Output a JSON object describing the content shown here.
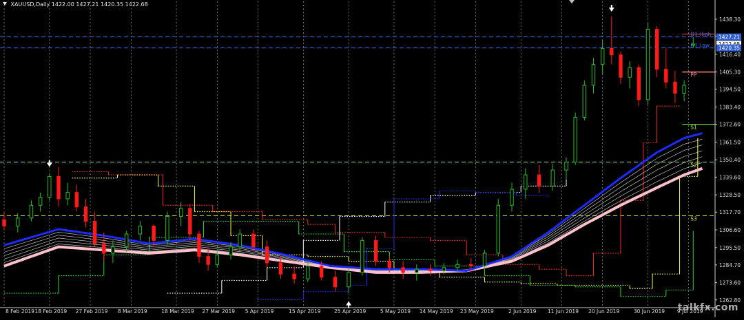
{
  "header": {
    "symbol": "XAUUSD,Daily",
    "ohlc": "1422.00 1427.21 1420.35 1422.68"
  },
  "watermark": "talkfx.com",
  "price_scale": {
    "ticks": [
      "1438.30",
      "1427.50",
      "1416.40",
      "1405.30",
      "1394.50",
      "1383.40",
      "1372.60",
      "1361.50",
      "1350.40",
      "1339.60",
      "1328.50",
      "1317.70",
      "1306.60",
      "1295.50",
      "1284.70",
      "1273.60",
      "1262.80"
    ],
    "tick_values": [
      1438.3,
      1427.5,
      1416.4,
      1405.3,
      1394.5,
      1383.4,
      1372.6,
      1361.5,
      1350.4,
      1339.6,
      1328.5,
      1317.7,
      1306.6,
      1295.5,
      1284.7,
      1273.6,
      1262.8
    ],
    "tags": [
      {
        "text": "1427.21",
        "value": 1427.21,
        "bg": "#2f5fd0",
        "fg": "#ffffff"
      },
      {
        "text": "1422.68",
        "value": 1422.68,
        "bg": "#ffffff",
        "fg": "#000000"
      },
      {
        "text": "1420.35",
        "value": 1420.35,
        "bg": "#2f5fd0",
        "fg": "#ffffff"
      }
    ]
  },
  "date_labels": [
    "8 Feb 2019",
    "18 Feb 2019",
    "27 Feb 2019",
    "8 Mar 2019",
    "18 Mar 2019",
    "27 Mar 2019",
    "5 Apr 2019",
    "15 Apr 2019",
    "25 Apr 2019",
    "5 May 2019",
    "14 May 2019",
    "23 May 2019",
    "2 Jun 2019",
    "11 Jun 2019",
    "20 Jun 2019",
    "30 Jun 2019",
    "9 Jul 2019"
  ],
  "level_lines": [
    {
      "label": "D1 High",
      "value": 1427.21,
      "color": "#2f6bff",
      "dash": true
    },
    {
      "label": "D1 Low",
      "value": 1420.35,
      "color": "#2f6bff",
      "dash": true
    },
    {
      "label": "",
      "value": 1429.0,
      "color": "#ff4040",
      "dash": false
    },
    {
      "label": "PP",
      "value": 1405.3,
      "color": "#ff8080",
      "dash": false
    },
    {
      "label": "S1",
      "value": 1372.6,
      "color": "#7fff3a",
      "dash": false
    },
    {
      "label": "S2",
      "value": 1349.0,
      "color": "#b4e04a",
      "dash": true
    },
    {
      "label": "S3",
      "value": 1315.5,
      "color": "#cfe040",
      "dash": true
    }
  ],
  "colors": {
    "background": "#000000",
    "bull": "#22c122",
    "bear": "#ff1a1a",
    "ma_fast": "#1a2cff",
    "ma_slow": "#ffc0cb",
    "ribbon": "#ffffff",
    "grid_dates": "#ffffff",
    "axis_text": "#dddddd"
  },
  "chart_data": {
    "type": "candlestick",
    "title": "XAUUSD,Daily",
    "ylim": [
      1258,
      1446
    ],
    "x_range_days": [
      0,
      155
    ],
    "date_label_days": [
      0,
      10,
      19,
      28,
      38,
      47,
      56,
      66,
      76,
      86,
      95,
      104,
      114,
      123,
      132,
      142,
      151
    ],
    "candles": [
      {
        "d": 0,
        "o": 1313,
        "h": 1318,
        "l": 1306,
        "c": 1309
      },
      {
        "d": 3,
        "o": 1309,
        "h": 1317,
        "l": 1305,
        "c": 1314
      },
      {
        "d": 6,
        "o": 1314,
        "h": 1325,
        "l": 1312,
        "c": 1322
      },
      {
        "d": 8,
        "o": 1322,
        "h": 1330,
        "l": 1318,
        "c": 1327
      },
      {
        "d": 10,
        "o": 1327,
        "h": 1342,
        "l": 1325,
        "c": 1340
      },
      {
        "d": 12,
        "o": 1340,
        "h": 1346,
        "l": 1321,
        "c": 1326
      },
      {
        "d": 14,
        "o": 1326,
        "h": 1336,
        "l": 1322,
        "c": 1330
      },
      {
        "d": 16,
        "o": 1330,
        "h": 1335,
        "l": 1318,
        "c": 1321
      },
      {
        "d": 18,
        "o": 1321,
        "h": 1326,
        "l": 1308,
        "c": 1312
      },
      {
        "d": 20,
        "o": 1312,
        "h": 1318,
        "l": 1296,
        "c": 1298
      },
      {
        "d": 22,
        "o": 1298,
        "h": 1305,
        "l": 1287,
        "c": 1292
      },
      {
        "d": 24,
        "o": 1292,
        "h": 1300,
        "l": 1286,
        "c": 1296
      },
      {
        "d": 27,
        "o": 1296,
        "h": 1306,
        "l": 1293,
        "c": 1304
      },
      {
        "d": 30,
        "o": 1304,
        "h": 1312,
        "l": 1300,
        "c": 1309
      },
      {
        "d": 33,
        "o": 1309,
        "h": 1310,
        "l": 1296,
        "c": 1300
      },
      {
        "d": 36,
        "o": 1300,
        "h": 1318,
        "l": 1297,
        "c": 1315
      },
      {
        "d": 39,
        "o": 1315,
        "h": 1324,
        "l": 1309,
        "c": 1320
      },
      {
        "d": 41,
        "o": 1320,
        "h": 1323,
        "l": 1300,
        "c": 1304
      },
      {
        "d": 43,
        "o": 1304,
        "h": 1306,
        "l": 1286,
        "c": 1290
      },
      {
        "d": 45,
        "o": 1290,
        "h": 1296,
        "l": 1281,
        "c": 1285
      },
      {
        "d": 47,
        "o": 1285,
        "h": 1294,
        "l": 1283,
        "c": 1291
      },
      {
        "d": 50,
        "o": 1291,
        "h": 1299,
        "l": 1288,
        "c": 1296
      },
      {
        "d": 52,
        "o": 1296,
        "h": 1307,
        "l": 1293,
        "c": 1304
      },
      {
        "d": 55,
        "o": 1304,
        "h": 1307,
        "l": 1293,
        "c": 1296
      },
      {
        "d": 58,
        "o": 1296,
        "h": 1300,
        "l": 1283,
        "c": 1286
      },
      {
        "d": 61,
        "o": 1286,
        "h": 1290,
        "l": 1276,
        "c": 1279
      },
      {
        "d": 64,
        "o": 1279,
        "h": 1284,
        "l": 1273,
        "c": 1276
      },
      {
        "d": 67,
        "o": 1276,
        "h": 1287,
        "l": 1274,
        "c": 1284
      },
      {
        "d": 70,
        "o": 1284,
        "h": 1287,
        "l": 1275,
        "c": 1277
      },
      {
        "d": 73,
        "o": 1277,
        "h": 1281,
        "l": 1268,
        "c": 1271
      },
      {
        "d": 76,
        "o": 1271,
        "h": 1283,
        "l": 1267,
        "c": 1280
      },
      {
        "d": 79,
        "o": 1280,
        "h": 1302,
        "l": 1278,
        "c": 1300
      },
      {
        "d": 82,
        "o": 1300,
        "h": 1303,
        "l": 1284,
        "c": 1287
      },
      {
        "d": 85,
        "o": 1287,
        "h": 1290,
        "l": 1280,
        "c": 1283
      },
      {
        "d": 88,
        "o": 1283,
        "h": 1287,
        "l": 1276,
        "c": 1280
      },
      {
        "d": 91,
        "o": 1280,
        "h": 1285,
        "l": 1275,
        "c": 1282
      },
      {
        "d": 94,
        "o": 1282,
        "h": 1285,
        "l": 1278,
        "c": 1281
      },
      {
        "d": 97,
        "o": 1281,
        "h": 1286,
        "l": 1279,
        "c": 1283
      },
      {
        "d": 100,
        "o": 1283,
        "h": 1288,
        "l": 1281,
        "c": 1285
      },
      {
        "d": 103,
        "o": 1285,
        "h": 1289,
        "l": 1280,
        "c": 1284
      },
      {
        "d": 106,
        "o": 1284,
        "h": 1294,
        "l": 1282,
        "c": 1292
      },
      {
        "d": 109,
        "o": 1292,
        "h": 1326,
        "l": 1290,
        "c": 1322
      },
      {
        "d": 112,
        "o": 1322,
        "h": 1336,
        "l": 1318,
        "c": 1332
      },
      {
        "d": 115,
        "o": 1332,
        "h": 1345,
        "l": 1326,
        "c": 1341
      },
      {
        "d": 118,
        "o": 1341,
        "h": 1347,
        "l": 1330,
        "c": 1334
      },
      {
        "d": 121,
        "o": 1334,
        "h": 1348,
        "l": 1331,
        "c": 1344
      },
      {
        "d": 124,
        "o": 1344,
        "h": 1352,
        "l": 1338,
        "c": 1349
      },
      {
        "d": 126,
        "o": 1349,
        "h": 1380,
        "l": 1347,
        "c": 1377
      },
      {
        "d": 128,
        "o": 1377,
        "h": 1400,
        "l": 1375,
        "c": 1397
      },
      {
        "d": 130,
        "o": 1397,
        "h": 1414,
        "l": 1392,
        "c": 1410
      },
      {
        "d": 132,
        "o": 1410,
        "h": 1425,
        "l": 1404,
        "c": 1420
      },
      {
        "d": 134,
        "o": 1420,
        "h": 1440,
        "l": 1410,
        "c": 1416
      },
      {
        "d": 136,
        "o": 1416,
        "h": 1418,
        "l": 1398,
        "c": 1402
      },
      {
        "d": 138,
        "o": 1402,
        "h": 1412,
        "l": 1395,
        "c": 1408
      },
      {
        "d": 140,
        "o": 1408,
        "h": 1410,
        "l": 1384,
        "c": 1388
      },
      {
        "d": 142,
        "o": 1388,
        "h": 1436,
        "l": 1385,
        "c": 1432
      },
      {
        "d": 144,
        "o": 1432,
        "h": 1434,
        "l": 1402,
        "c": 1407
      },
      {
        "d": 146,
        "o": 1407,
        "h": 1420,
        "l": 1395,
        "c": 1399
      },
      {
        "d": 148,
        "o": 1399,
        "h": 1406,
        "l": 1386,
        "c": 1392
      },
      {
        "d": 150,
        "o": 1392,
        "h": 1400,
        "l": 1387,
        "c": 1397
      },
      {
        "d": 152,
        "o": 1422,
        "h": 1427.21,
        "l": 1420.35,
        "c": 1422.68
      }
    ],
    "ma_fast": [
      [
        0,
        1297
      ],
      [
        12,
        1307
      ],
      [
        22,
        1303
      ],
      [
        32,
        1298
      ],
      [
        42,
        1301
      ],
      [
        52,
        1297
      ],
      [
        62,
        1291
      ],
      [
        72,
        1284
      ],
      [
        82,
        1282
      ],
      [
        92,
        1282
      ],
      [
        102,
        1281
      ],
      [
        112,
        1290
      ],
      [
        120,
        1305
      ],
      [
        128,
        1322
      ],
      [
        136,
        1339
      ],
      [
        144,
        1355
      ],
      [
        150,
        1364
      ],
      [
        154,
        1367
      ]
    ],
    "ma_slow": [
      [
        0,
        1284
      ],
      [
        12,
        1296
      ],
      [
        22,
        1294
      ],
      [
        32,
        1292
      ],
      [
        42,
        1294
      ],
      [
        52,
        1291
      ],
      [
        62,
        1287
      ],
      [
        72,
        1283
      ],
      [
        82,
        1280
      ],
      [
        92,
        1280
      ],
      [
        102,
        1281
      ],
      [
        112,
        1287
      ],
      [
        120,
        1297
      ],
      [
        128,
        1310
      ],
      [
        136,
        1322
      ],
      [
        144,
        1333
      ],
      [
        150,
        1341
      ],
      [
        154,
        1345
      ]
    ],
    "trails": [
      {
        "color": "#ff2020",
        "points": [
          [
            15,
            1343
          ],
          [
            23,
            1341
          ],
          [
            35,
            1322
          ],
          [
            46,
            1318
          ],
          [
            57,
            1313
          ],
          [
            67,
            1310
          ],
          [
            73,
            1305
          ],
          [
            84,
            1302
          ],
          [
            94,
            1300
          ],
          [
            102,
            1291
          ],
          [
            110,
            1285
          ],
          [
            118,
            1282
          ],
          [
            124,
            1278
          ],
          [
            130,
            1292
          ],
          [
            136,
            1325
          ],
          [
            141,
            1361
          ],
          [
            144,
            1384
          ],
          [
            149,
            1384
          ]
        ]
      },
      {
        "color": "#ffff40",
        "points": [
          [
            15,
            1339
          ],
          [
            25,
            1341
          ],
          [
            34,
            1334
          ],
          [
            42,
            1318
          ],
          [
            50,
            1303
          ],
          [
            57,
            1291
          ],
          [
            67,
            1290
          ],
          [
            76,
            1287
          ],
          [
            86,
            1281
          ],
          [
            96,
            1277
          ],
          [
            106,
            1274
          ],
          [
            114,
            1273
          ],
          [
            122,
            1272
          ],
          [
            130,
            1272
          ],
          [
            138,
            1270
          ],
          [
            143,
            1279
          ],
          [
            149,
            1340
          ],
          [
            153,
            1364
          ]
        ]
      },
      {
        "color": "#20e020",
        "points": [
          [
            0,
            1267
          ],
          [
            12,
            1278
          ],
          [
            22,
            1291
          ],
          [
            32,
            1302
          ],
          [
            44,
            1312
          ],
          [
            55,
            1312
          ],
          [
            65,
            1304
          ],
          [
            75,
            1293
          ],
          [
            85,
            1288
          ],
          [
            95,
            1284
          ],
          [
            106,
            1278
          ],
          [
            116,
            1272
          ],
          [
            126,
            1271
          ],
          [
            136,
            1265
          ],
          [
            146,
            1269
          ],
          [
            152,
            1306
          ]
        ]
      },
      {
        "color": "#ffffff",
        "points": [
          [
            36,
            1267
          ],
          [
            48,
            1275
          ],
          [
            58,
            1283
          ],
          [
            66,
            1300
          ],
          [
            74,
            1315
          ],
          [
            84,
            1324
          ],
          [
            94,
            1328
          ],
          [
            104,
            1330
          ],
          [
            114,
            1334
          ],
          [
            124,
            1339
          ]
        ]
      },
      {
        "color": "#1a2cff",
        "points": [
          [
            56,
            1263
          ],
          [
            66,
            1268
          ],
          [
            76,
            1272
          ],
          [
            80,
            1295
          ],
          [
            86,
            1326
          ],
          [
            96,
            1331
          ],
          [
            104,
            1330
          ],
          [
            113,
            1328
          ],
          [
            120,
            1327
          ]
        ]
      }
    ]
  }
}
